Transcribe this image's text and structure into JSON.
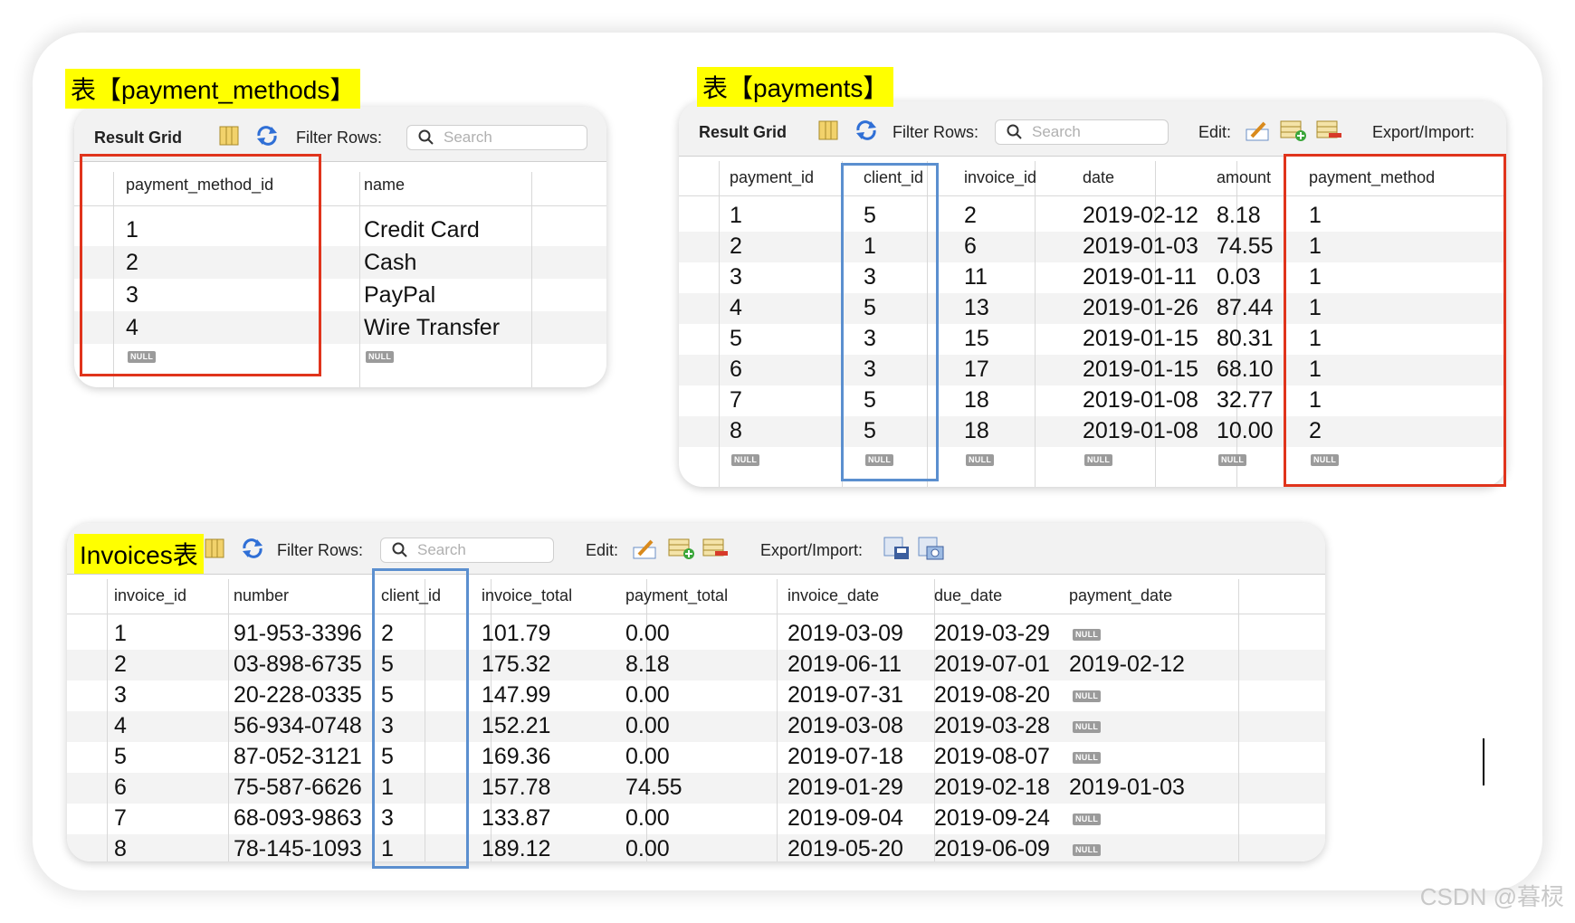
{
  "labels": {
    "payment_methods": "表【payment_methods】",
    "payments": "表【payments】",
    "invoices": "Invoices表"
  },
  "toolbar": {
    "result_grid": "Result Grid",
    "filter_rows": "Filter Rows:",
    "search_placeholder": "Search",
    "edit": "Edit:",
    "export_import": "Export/Import:"
  },
  "null_badge": "NULL",
  "payment_methods": {
    "columns": [
      "payment_method_id",
      "name"
    ],
    "rows": [
      [
        "1",
        "Credit Card"
      ],
      [
        "2",
        "Cash"
      ],
      [
        "3",
        "PayPal"
      ],
      [
        "4",
        "Wire Transfer"
      ]
    ]
  },
  "payments": {
    "columns": [
      "payment_id",
      "client_id",
      "invoice_id",
      "date",
      "amount",
      "payment_method"
    ],
    "rows": [
      [
        "1",
        "5",
        "2",
        "2019-02-12",
        "8.18",
        "1"
      ],
      [
        "2",
        "1",
        "6",
        "2019-01-03",
        "74.55",
        "1"
      ],
      [
        "3",
        "3",
        "11",
        "2019-01-11",
        "0.03",
        "1"
      ],
      [
        "4",
        "5",
        "13",
        "2019-01-26",
        "87.44",
        "1"
      ],
      [
        "5",
        "3",
        "15",
        "2019-01-15",
        "80.31",
        "1"
      ],
      [
        "6",
        "3",
        "17",
        "2019-01-15",
        "68.10",
        "1"
      ],
      [
        "7",
        "5",
        "18",
        "2019-01-08",
        "32.77",
        "1"
      ],
      [
        "8",
        "5",
        "18",
        "2019-01-08",
        "10.00",
        "2"
      ]
    ]
  },
  "invoices": {
    "columns": [
      "invoice_id",
      "number",
      "client_id",
      "invoice_total",
      "payment_total",
      "invoice_date",
      "due_date",
      "payment_date"
    ],
    "rows": [
      [
        "1",
        "91-953-3396",
        "2",
        "101.79",
        "0.00",
        "2019-03-09",
        "2019-03-29",
        null
      ],
      [
        "2",
        "03-898-6735",
        "5",
        "175.32",
        "8.18",
        "2019-06-11",
        "2019-07-01",
        "2019-02-12"
      ],
      [
        "3",
        "20-228-0335",
        "5",
        "147.99",
        "0.00",
        "2019-07-31",
        "2019-08-20",
        null
      ],
      [
        "4",
        "56-934-0748",
        "3",
        "152.21",
        "0.00",
        "2019-03-08",
        "2019-03-28",
        null
      ],
      [
        "5",
        "87-052-3121",
        "5",
        "169.36",
        "0.00",
        "2019-07-18",
        "2019-08-07",
        null
      ],
      [
        "6",
        "75-587-6626",
        "1",
        "157.78",
        "74.55",
        "2019-01-29",
        "2019-02-18",
        "2019-01-03"
      ],
      [
        "7",
        "68-093-9863",
        "3",
        "133.87",
        "0.00",
        "2019-09-04",
        "2019-09-24",
        null
      ],
      [
        "8",
        "78-145-1093",
        "1",
        "189.12",
        "0.00",
        "2019-05-20",
        "2019-06-09",
        null
      ]
    ]
  },
  "watermark": "CSDN @暮棂",
  "colors": {
    "highlight_label": "#ffff00",
    "red_box": "#e0341c",
    "blue_box": "#5b8fcf"
  }
}
